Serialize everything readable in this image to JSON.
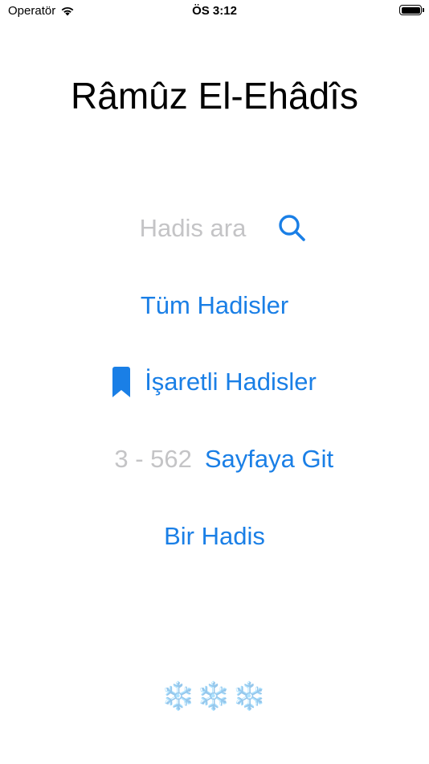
{
  "status": {
    "carrier": "Operatör",
    "time": "ÖS 3:12"
  },
  "title": "Râmûz El-Ehâdîs",
  "search": {
    "placeholder": "Hadis ara"
  },
  "menu": {
    "all_hadiths": "Tüm Hadisler",
    "marked_hadiths": "İşaretli Hadisler",
    "page_placeholder": "3 - 562",
    "go_to_page": "Sayfaya Git",
    "one_hadith": "Bir Hadis"
  },
  "footer": {
    "decoration": "❄️❄️❄️"
  },
  "colors": {
    "accent": "#1a7fe6",
    "placeholder": "#c4c4c6"
  }
}
